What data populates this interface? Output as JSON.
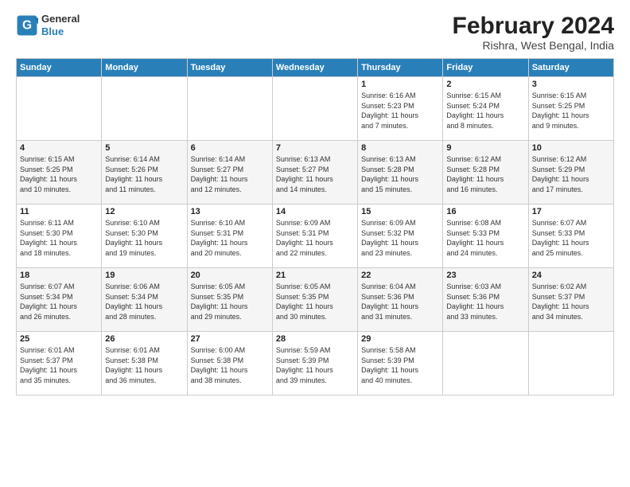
{
  "logo": {
    "line1": "General",
    "line2": "Blue"
  },
  "title": "February 2024",
  "subtitle": "Rishra, West Bengal, India",
  "headers": [
    "Sunday",
    "Monday",
    "Tuesday",
    "Wednesday",
    "Thursday",
    "Friday",
    "Saturday"
  ],
  "weeks": [
    [
      {
        "day": "",
        "info": ""
      },
      {
        "day": "",
        "info": ""
      },
      {
        "day": "",
        "info": ""
      },
      {
        "day": "",
        "info": ""
      },
      {
        "day": "1",
        "info": "Sunrise: 6:16 AM\nSunset: 5:23 PM\nDaylight: 11 hours\nand 7 minutes."
      },
      {
        "day": "2",
        "info": "Sunrise: 6:15 AM\nSunset: 5:24 PM\nDaylight: 11 hours\nand 8 minutes."
      },
      {
        "day": "3",
        "info": "Sunrise: 6:15 AM\nSunset: 5:25 PM\nDaylight: 11 hours\nand 9 minutes."
      }
    ],
    [
      {
        "day": "4",
        "info": "Sunrise: 6:15 AM\nSunset: 5:25 PM\nDaylight: 11 hours\nand 10 minutes."
      },
      {
        "day": "5",
        "info": "Sunrise: 6:14 AM\nSunset: 5:26 PM\nDaylight: 11 hours\nand 11 minutes."
      },
      {
        "day": "6",
        "info": "Sunrise: 6:14 AM\nSunset: 5:27 PM\nDaylight: 11 hours\nand 12 minutes."
      },
      {
        "day": "7",
        "info": "Sunrise: 6:13 AM\nSunset: 5:27 PM\nDaylight: 11 hours\nand 14 minutes."
      },
      {
        "day": "8",
        "info": "Sunrise: 6:13 AM\nSunset: 5:28 PM\nDaylight: 11 hours\nand 15 minutes."
      },
      {
        "day": "9",
        "info": "Sunrise: 6:12 AM\nSunset: 5:28 PM\nDaylight: 11 hours\nand 16 minutes."
      },
      {
        "day": "10",
        "info": "Sunrise: 6:12 AM\nSunset: 5:29 PM\nDaylight: 11 hours\nand 17 minutes."
      }
    ],
    [
      {
        "day": "11",
        "info": "Sunrise: 6:11 AM\nSunset: 5:30 PM\nDaylight: 11 hours\nand 18 minutes."
      },
      {
        "day": "12",
        "info": "Sunrise: 6:10 AM\nSunset: 5:30 PM\nDaylight: 11 hours\nand 19 minutes."
      },
      {
        "day": "13",
        "info": "Sunrise: 6:10 AM\nSunset: 5:31 PM\nDaylight: 11 hours\nand 20 minutes."
      },
      {
        "day": "14",
        "info": "Sunrise: 6:09 AM\nSunset: 5:31 PM\nDaylight: 11 hours\nand 22 minutes."
      },
      {
        "day": "15",
        "info": "Sunrise: 6:09 AM\nSunset: 5:32 PM\nDaylight: 11 hours\nand 23 minutes."
      },
      {
        "day": "16",
        "info": "Sunrise: 6:08 AM\nSunset: 5:33 PM\nDaylight: 11 hours\nand 24 minutes."
      },
      {
        "day": "17",
        "info": "Sunrise: 6:07 AM\nSunset: 5:33 PM\nDaylight: 11 hours\nand 25 minutes."
      }
    ],
    [
      {
        "day": "18",
        "info": "Sunrise: 6:07 AM\nSunset: 5:34 PM\nDaylight: 11 hours\nand 26 minutes."
      },
      {
        "day": "19",
        "info": "Sunrise: 6:06 AM\nSunset: 5:34 PM\nDaylight: 11 hours\nand 28 minutes."
      },
      {
        "day": "20",
        "info": "Sunrise: 6:05 AM\nSunset: 5:35 PM\nDaylight: 11 hours\nand 29 minutes."
      },
      {
        "day": "21",
        "info": "Sunrise: 6:05 AM\nSunset: 5:35 PM\nDaylight: 11 hours\nand 30 minutes."
      },
      {
        "day": "22",
        "info": "Sunrise: 6:04 AM\nSunset: 5:36 PM\nDaylight: 11 hours\nand 31 minutes."
      },
      {
        "day": "23",
        "info": "Sunrise: 6:03 AM\nSunset: 5:36 PM\nDaylight: 11 hours\nand 33 minutes."
      },
      {
        "day": "24",
        "info": "Sunrise: 6:02 AM\nSunset: 5:37 PM\nDaylight: 11 hours\nand 34 minutes."
      }
    ],
    [
      {
        "day": "25",
        "info": "Sunrise: 6:01 AM\nSunset: 5:37 PM\nDaylight: 11 hours\nand 35 minutes."
      },
      {
        "day": "26",
        "info": "Sunrise: 6:01 AM\nSunset: 5:38 PM\nDaylight: 11 hours\nand 36 minutes."
      },
      {
        "day": "27",
        "info": "Sunrise: 6:00 AM\nSunset: 5:38 PM\nDaylight: 11 hours\nand 38 minutes."
      },
      {
        "day": "28",
        "info": "Sunrise: 5:59 AM\nSunset: 5:39 PM\nDaylight: 11 hours\nand 39 minutes."
      },
      {
        "day": "29",
        "info": "Sunrise: 5:58 AM\nSunset: 5:39 PM\nDaylight: 11 hours\nand 40 minutes."
      },
      {
        "day": "",
        "info": ""
      },
      {
        "day": "",
        "info": ""
      }
    ]
  ]
}
